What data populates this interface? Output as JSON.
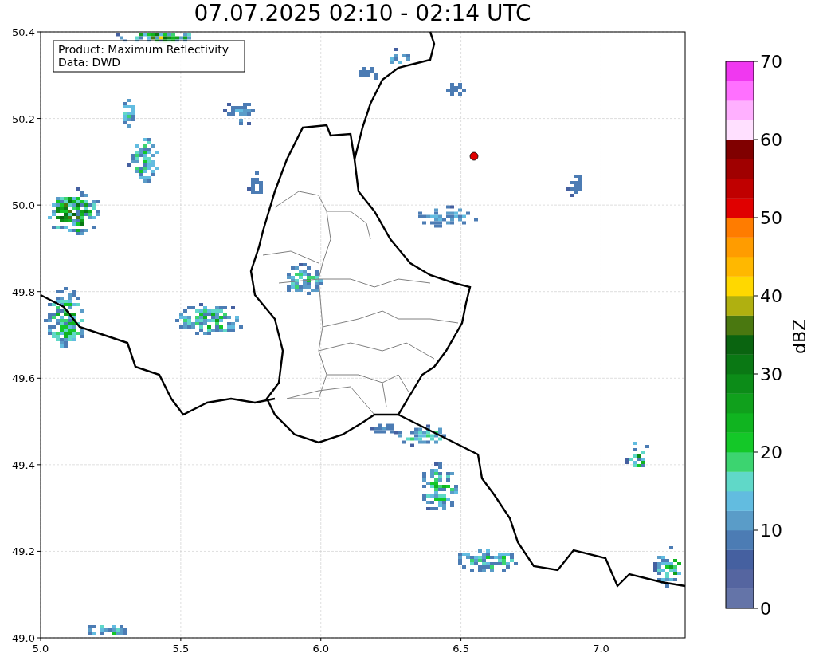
{
  "title": "07.07.2025 02:10 - 02:14 UTC",
  "info_box": [
    "Product: Maximum Reflectivity",
    "Data: DWD"
  ],
  "map": {
    "xticks": [
      "5.0",
      "5.5",
      "6.0",
      "6.5",
      "7.0"
    ],
    "yticks": [
      "50.4",
      "50.2",
      "50.0",
      "49.8",
      "49.6",
      "49.4",
      "49.2",
      "49.0"
    ]
  },
  "colorbar": {
    "label": "dBZ",
    "ticks": [
      "70",
      "60",
      "50",
      "40",
      "30",
      "20",
      "10",
      "0"
    ],
    "bands": [
      {
        "color": "#6474a8"
      },
      {
        "color": "#5565a0"
      },
      {
        "color": "#4560a0"
      },
      {
        "color": "#4c7cb4"
      },
      {
        "color": "#5a9cc8"
      },
      {
        "color": "#62bce0"
      },
      {
        "color": "#60d8c8"
      },
      {
        "color": "#3cd470"
      },
      {
        "color": "#14c828"
      },
      {
        "color": "#10b420"
      },
      {
        "color": "#10a01c"
      },
      {
        "color": "#0c8c18"
      },
      {
        "color": "#0a7814"
      },
      {
        "color": "#0a6410"
      },
      {
        "color": "#4a7810"
      },
      {
        "color": "#b0b010"
      },
      {
        "color": "#ffd800"
      },
      {
        "color": "#ffb800"
      },
      {
        "color": "#ff9c00"
      },
      {
        "color": "#ff7c00"
      },
      {
        "color": "#e00000"
      },
      {
        "color": "#c00000"
      },
      {
        "color": "#a00000"
      },
      {
        "color": "#800000"
      },
      {
        "color": "#ffe0ff"
      },
      {
        "color": "#ffb0ff"
      },
      {
        "color": "#ff70ff"
      },
      {
        "color": "#f038f0"
      }
    ]
  }
}
